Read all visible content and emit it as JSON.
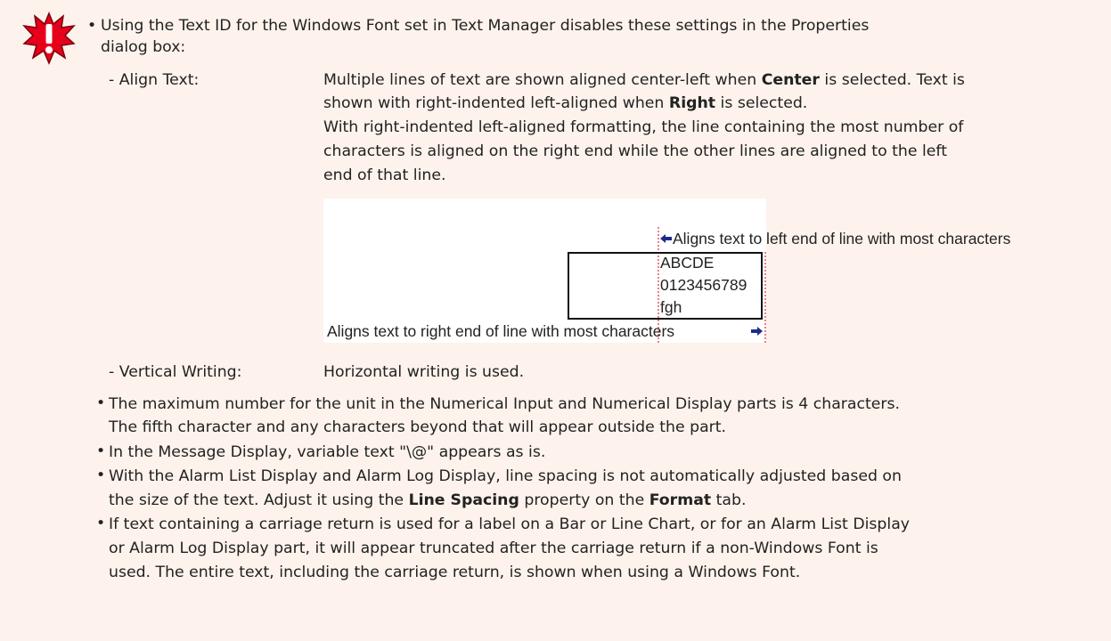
{
  "warning_icon": "exclamation-burst-icon",
  "intro": "Using the Text ID for the Windows Font set in Text Manager disables these settings in the Properties",
  "intro_cont": "dialog box:",
  "align": {
    "label": "- Align Text:",
    "l1_pre": "Multiple lines of text are shown aligned center-left when ",
    "l1_bold": "Center",
    "l1_post": " is selected. Text is",
    "l2_pre": "shown with right-indented left-aligned when ",
    "l2_bold": "Right",
    "l2_post": " is selected.",
    "l3": "With right-indented left-aligned formatting, the line containing the most number of",
    "l4": "characters is aligned on the right end while the other lines are aligned to the left",
    "l5": "end of that line."
  },
  "figure": {
    "top_note": "Aligns text to left end of line with most characters",
    "lines": [
      "ABCDE",
      "0123456789",
      "fgh"
    ],
    "bottom_note": "Aligns text to right end of line with most characters"
  },
  "vertical": {
    "label": "- Vertical Writing:",
    "text": "Horizontal writing is used."
  },
  "bullets": {
    "b1_l1": "The maximum number for the unit in the Numerical Input and Numerical Display parts is 4 characters.",
    "b1_l2": "The fifth character and any characters beyond that will appear outside the part.",
    "b2": "In the Message Display, variable text \"\\@\" appears as is.",
    "b3_l1": "With the Alarm List Display and Alarm Log Display, line spacing is not automatically adjusted based on",
    "b3_l2_pre": "the size of the text. Adjust it using the ",
    "b3_l2_bold1": "Line Spacing",
    "b3_l2_mid": " property on the ",
    "b3_l2_bold2": "Format",
    "b3_l2_post": " tab.",
    "b4_l1": "If text containing a carriage return is used for a label on a Bar or Line Chart, or for an Alarm List Display",
    "b4_l2": "or Alarm Log Display part, it will appear truncated after the carriage return if a non-Windows Font is",
    "b4_l3": "used. The entire text, including the carriage return, is shown when using a Windows Font."
  },
  "colors": {
    "background": "#fdf3ec",
    "icon_red": "#e6001a",
    "arrow_blue": "#1f2a8a",
    "guide_red": "#d0021b"
  }
}
